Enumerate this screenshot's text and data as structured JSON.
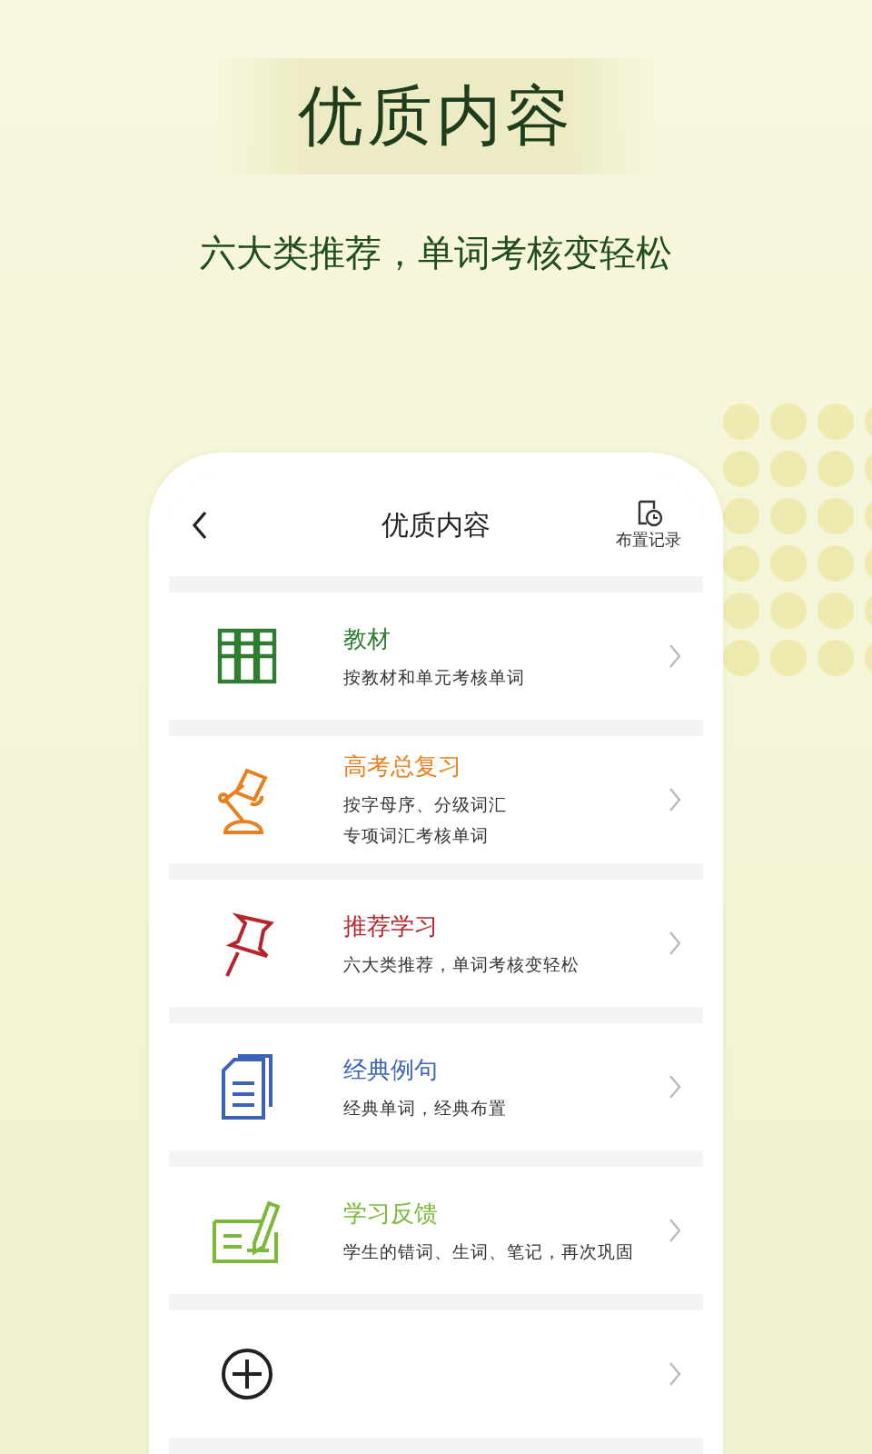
{
  "headline": "优质内容",
  "tagline": "六大类推荐，单词考核变轻松",
  "screen": {
    "title": "优质内容",
    "action_label": "布置记录",
    "items": [
      {
        "kind": "books",
        "title": "教材",
        "color": "#2f7d32",
        "desc": [
          "按教材和单元考核单词"
        ]
      },
      {
        "kind": "lamp",
        "title": "高考总复习",
        "color": "#e8801f",
        "desc": [
          "按字母序、分级词汇",
          "专项词汇考核单词"
        ]
      },
      {
        "kind": "pin",
        "title": "推荐学习",
        "color": "#b3262c",
        "desc": [
          "六大类推荐，单词考核变轻松"
        ]
      },
      {
        "kind": "document",
        "title": "经典例句",
        "color": "#3c63b8",
        "desc": [
          "经典单词，经典布置"
        ]
      },
      {
        "kind": "pencil",
        "title": "学习反馈",
        "color": "#7cb83a",
        "desc": [
          "学生的错词、生词、笔记，再次巩固"
        ]
      },
      {
        "kind": "add"
      }
    ]
  }
}
